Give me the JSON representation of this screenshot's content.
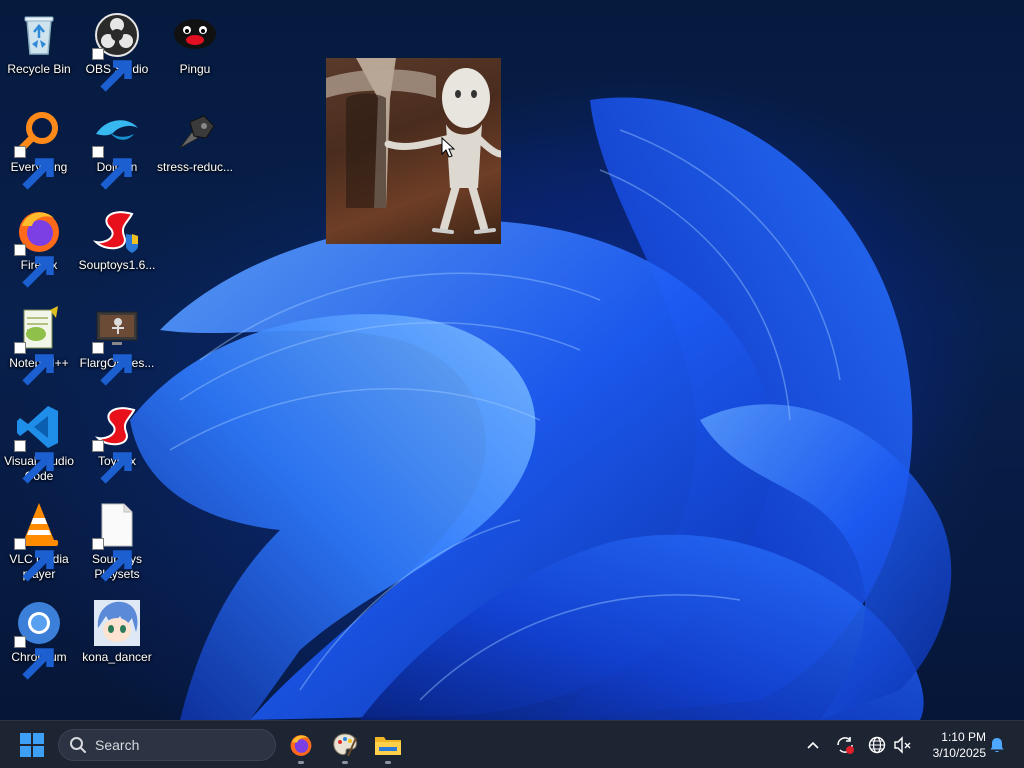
{
  "desktop": {
    "icons": [
      {
        "label": "Recycle Bin",
        "icon": "recycle-bin-icon"
      },
      {
        "label": "OBS Studio",
        "icon": "obs-studio-icon"
      },
      {
        "label": "Pingu",
        "icon": "pingu-icon"
      },
      {
        "label": "Everything",
        "icon": "everything-search-icon"
      },
      {
        "label": "Dolphin",
        "icon": "dolphin-icon"
      },
      {
        "label": "stress-reduc...",
        "icon": "stress-reducer-icon"
      },
      {
        "label": "Firefox",
        "icon": "firefox-icon"
      },
      {
        "label": "Souptoys1.6...",
        "icon": "souptoys-installer-icon"
      },
      {
        "label": "Notepad++",
        "icon": "notepad-plus-plus-icon"
      },
      {
        "label": "FlargOnDes...",
        "icon": "flarg-on-desktop-icon"
      },
      {
        "label": "Visual Studio Code",
        "icon": "vscode-icon"
      },
      {
        "label": "Toybox",
        "icon": "toybox-icon"
      },
      {
        "label": "VLC media player",
        "icon": "vlc-icon"
      },
      {
        "label": "Souptoys Playsets",
        "icon": "blank-file-icon"
      },
      {
        "label": "Chromium",
        "icon": "chromium-icon"
      },
      {
        "label": "kona_dancer",
        "icon": "kona-dancer-icon"
      }
    ],
    "overlay": {
      "name": "flarg-desktop-pet",
      "icon": "creature-image"
    }
  },
  "taskbar": {
    "start_icon": "windows-logo-icon",
    "search_placeholder": "Search",
    "pinned_apps": [
      {
        "name": "Firefox",
        "icon": "firefox-icon",
        "running": true
      },
      {
        "name": "Paint",
        "icon": "paint-palette-icon",
        "running": true
      },
      {
        "name": "File Explorer",
        "icon": "folder-icon",
        "running": true
      }
    ],
    "tray": {
      "icons": [
        "chevron-up-icon",
        "sync-alert-icon",
        "network-globe-icon",
        "volume-muted-icon",
        "notification-bell-icon"
      ],
      "time": "1:10 PM",
      "date": "3/10/2025"
    }
  },
  "colors": {
    "taskbar_bg": "#1d2432",
    "wallpaper_accent": "#1f5cff",
    "windows_blue": "#3ea0f5"
  }
}
